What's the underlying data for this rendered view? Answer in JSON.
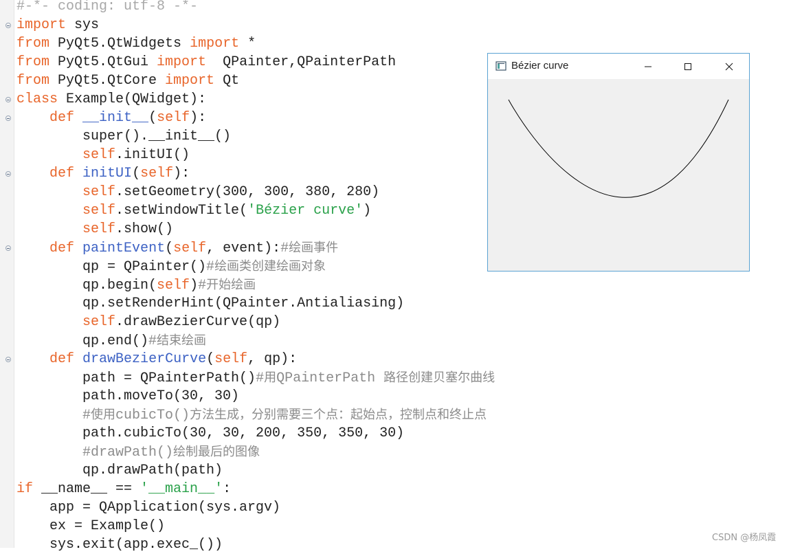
{
  "editor": {
    "lines": [
      [
        {
          "t": "#-*- coding: utf-8 -*-",
          "c": "cmt"
        }
      ],
      [
        {
          "t": "import",
          "c": "kw"
        },
        {
          "t": " sys"
        }
      ],
      [
        {
          "t": "from",
          "c": "kw"
        },
        {
          "t": " PyQt5.QtWidgets "
        },
        {
          "t": "import",
          "c": "kw"
        },
        {
          "t": " *"
        }
      ],
      [
        {
          "t": "from",
          "c": "kw"
        },
        {
          "t": " PyQt5.QtGui "
        },
        {
          "t": "import",
          "c": "kw"
        },
        {
          "t": "  QPainter,QPainterPath"
        }
      ],
      [
        {
          "t": "from",
          "c": "kw"
        },
        {
          "t": " PyQt5.QtCore "
        },
        {
          "t": "import",
          "c": "kw"
        },
        {
          "t": " Qt"
        }
      ],
      [
        {
          "t": "class",
          "c": "kw"
        },
        {
          "t": " Example(QWidget):"
        }
      ],
      [
        {
          "t": "    "
        },
        {
          "t": "def",
          "c": "kw"
        },
        {
          "t": " "
        },
        {
          "t": "__init__",
          "c": "fn"
        },
        {
          "t": "("
        },
        {
          "t": "self",
          "c": "kw"
        },
        {
          "t": "):"
        }
      ],
      [
        {
          "t": "        super().__init__()"
        }
      ],
      [
        {
          "t": "        "
        },
        {
          "t": "self",
          "c": "kw"
        },
        {
          "t": ".initUI()"
        }
      ],
      [
        {
          "t": "    "
        },
        {
          "t": "def",
          "c": "kw"
        },
        {
          "t": " "
        },
        {
          "t": "initUI",
          "c": "fn"
        },
        {
          "t": "("
        },
        {
          "t": "self",
          "c": "kw"
        },
        {
          "t": "):"
        }
      ],
      [
        {
          "t": "        "
        },
        {
          "t": "self",
          "c": "kw"
        },
        {
          "t": ".setGeometry(300, 300, 380, 280)"
        }
      ],
      [
        {
          "t": "        "
        },
        {
          "t": "self",
          "c": "kw"
        },
        {
          "t": ".setWindowTitle("
        },
        {
          "t": "'Bézier curve'",
          "c": "st"
        },
        {
          "t": ")"
        }
      ],
      [
        {
          "t": "        "
        },
        {
          "t": "self",
          "c": "kw"
        },
        {
          "t": ".show()"
        }
      ],
      [
        {
          "t": "    "
        },
        {
          "t": "def",
          "c": "kw"
        },
        {
          "t": " "
        },
        {
          "t": "paintEvent",
          "c": "fn"
        },
        {
          "t": "("
        },
        {
          "t": "self",
          "c": "kw"
        },
        {
          "t": ", event):"
        },
        {
          "t": "#",
          "c": "cm"
        },
        {
          "t": "绘画事件",
          "c": "cmz"
        }
      ],
      [
        {
          "t": "        qp = QPainter()"
        },
        {
          "t": "#",
          "c": "cm"
        },
        {
          "t": "绘画类创建绘画对象",
          "c": "cmz"
        }
      ],
      [
        {
          "t": "        qp.begin("
        },
        {
          "t": "self",
          "c": "kw"
        },
        {
          "t": ")"
        },
        {
          "t": "#",
          "c": "cm"
        },
        {
          "t": "开始绘画",
          "c": "cmz"
        }
      ],
      [
        {
          "t": "        qp.setRenderHint(QPainter.Antialiasing)"
        }
      ],
      [
        {
          "t": "        "
        },
        {
          "t": "self",
          "c": "kw"
        },
        {
          "t": ".drawBezierCurve(qp)"
        }
      ],
      [
        {
          "t": "        qp.end()"
        },
        {
          "t": "#",
          "c": "cm"
        },
        {
          "t": "结束绘画",
          "c": "cmz"
        }
      ],
      [
        {
          "t": "    "
        },
        {
          "t": "def",
          "c": "kw"
        },
        {
          "t": " "
        },
        {
          "t": "drawBezierCurve",
          "c": "fn"
        },
        {
          "t": "("
        },
        {
          "t": "self",
          "c": "kw"
        },
        {
          "t": ", qp):"
        }
      ],
      [
        {
          "t": "        path = QPainterPath()"
        },
        {
          "t": "#",
          "c": "cm"
        },
        {
          "t": "用",
          "c": "cmz"
        },
        {
          "t": "QPainterPath ",
          "c": "cm"
        },
        {
          "t": "路径创建贝塞尔曲线",
          "c": "cmz"
        }
      ],
      [
        {
          "t": "        path.moveTo(30, 30)"
        }
      ],
      [
        {
          "t": "        "
        },
        {
          "t": "#",
          "c": "cm"
        },
        {
          "t": "使用",
          "c": "cmz"
        },
        {
          "t": "cubicTo()",
          "c": "cm"
        },
        {
          "t": "方法生成，分别需要三个点：起始点，控制点和终止点",
          "c": "cmz"
        }
      ],
      [
        {
          "t": "        path.cubicTo(30, 30, 200, 350, 350, 30)"
        }
      ],
      [
        {
          "t": "        "
        },
        {
          "t": "#drawPath()",
          "c": "cm"
        },
        {
          "t": "绘制最后的图像",
          "c": "cmz"
        }
      ],
      [
        {
          "t": "        qp.drawPath(path)"
        }
      ],
      [
        {
          "t": "if",
          "c": "kw"
        },
        {
          "t": " __name__ == "
        },
        {
          "t": "'__main__'",
          "c": "st"
        },
        {
          "t": ":"
        }
      ],
      [
        {
          "t": "    app = QApplication(sys.argv)"
        }
      ],
      [
        {
          "t": "    ex = Example()"
        }
      ],
      [
        {
          "t": "    sys.exit(app.exec_())"
        }
      ]
    ],
    "fold_markers": [
      1,
      5,
      6,
      9,
      13,
      19
    ]
  },
  "window": {
    "title": "Bézier curve",
    "icon": "app-window-icon",
    "buttons": [
      "minimize-icon",
      "maximize-icon",
      "close-icon"
    ],
    "curve": {
      "start": [
        30,
        30
      ],
      "control1": [
        30,
        30
      ],
      "control2": [
        200,
        350
      ],
      "end": [
        350,
        30
      ]
    },
    "curve_color": "#000000",
    "background": "#f0f0f0"
  },
  "watermark": "CSDN @杨凤霞"
}
